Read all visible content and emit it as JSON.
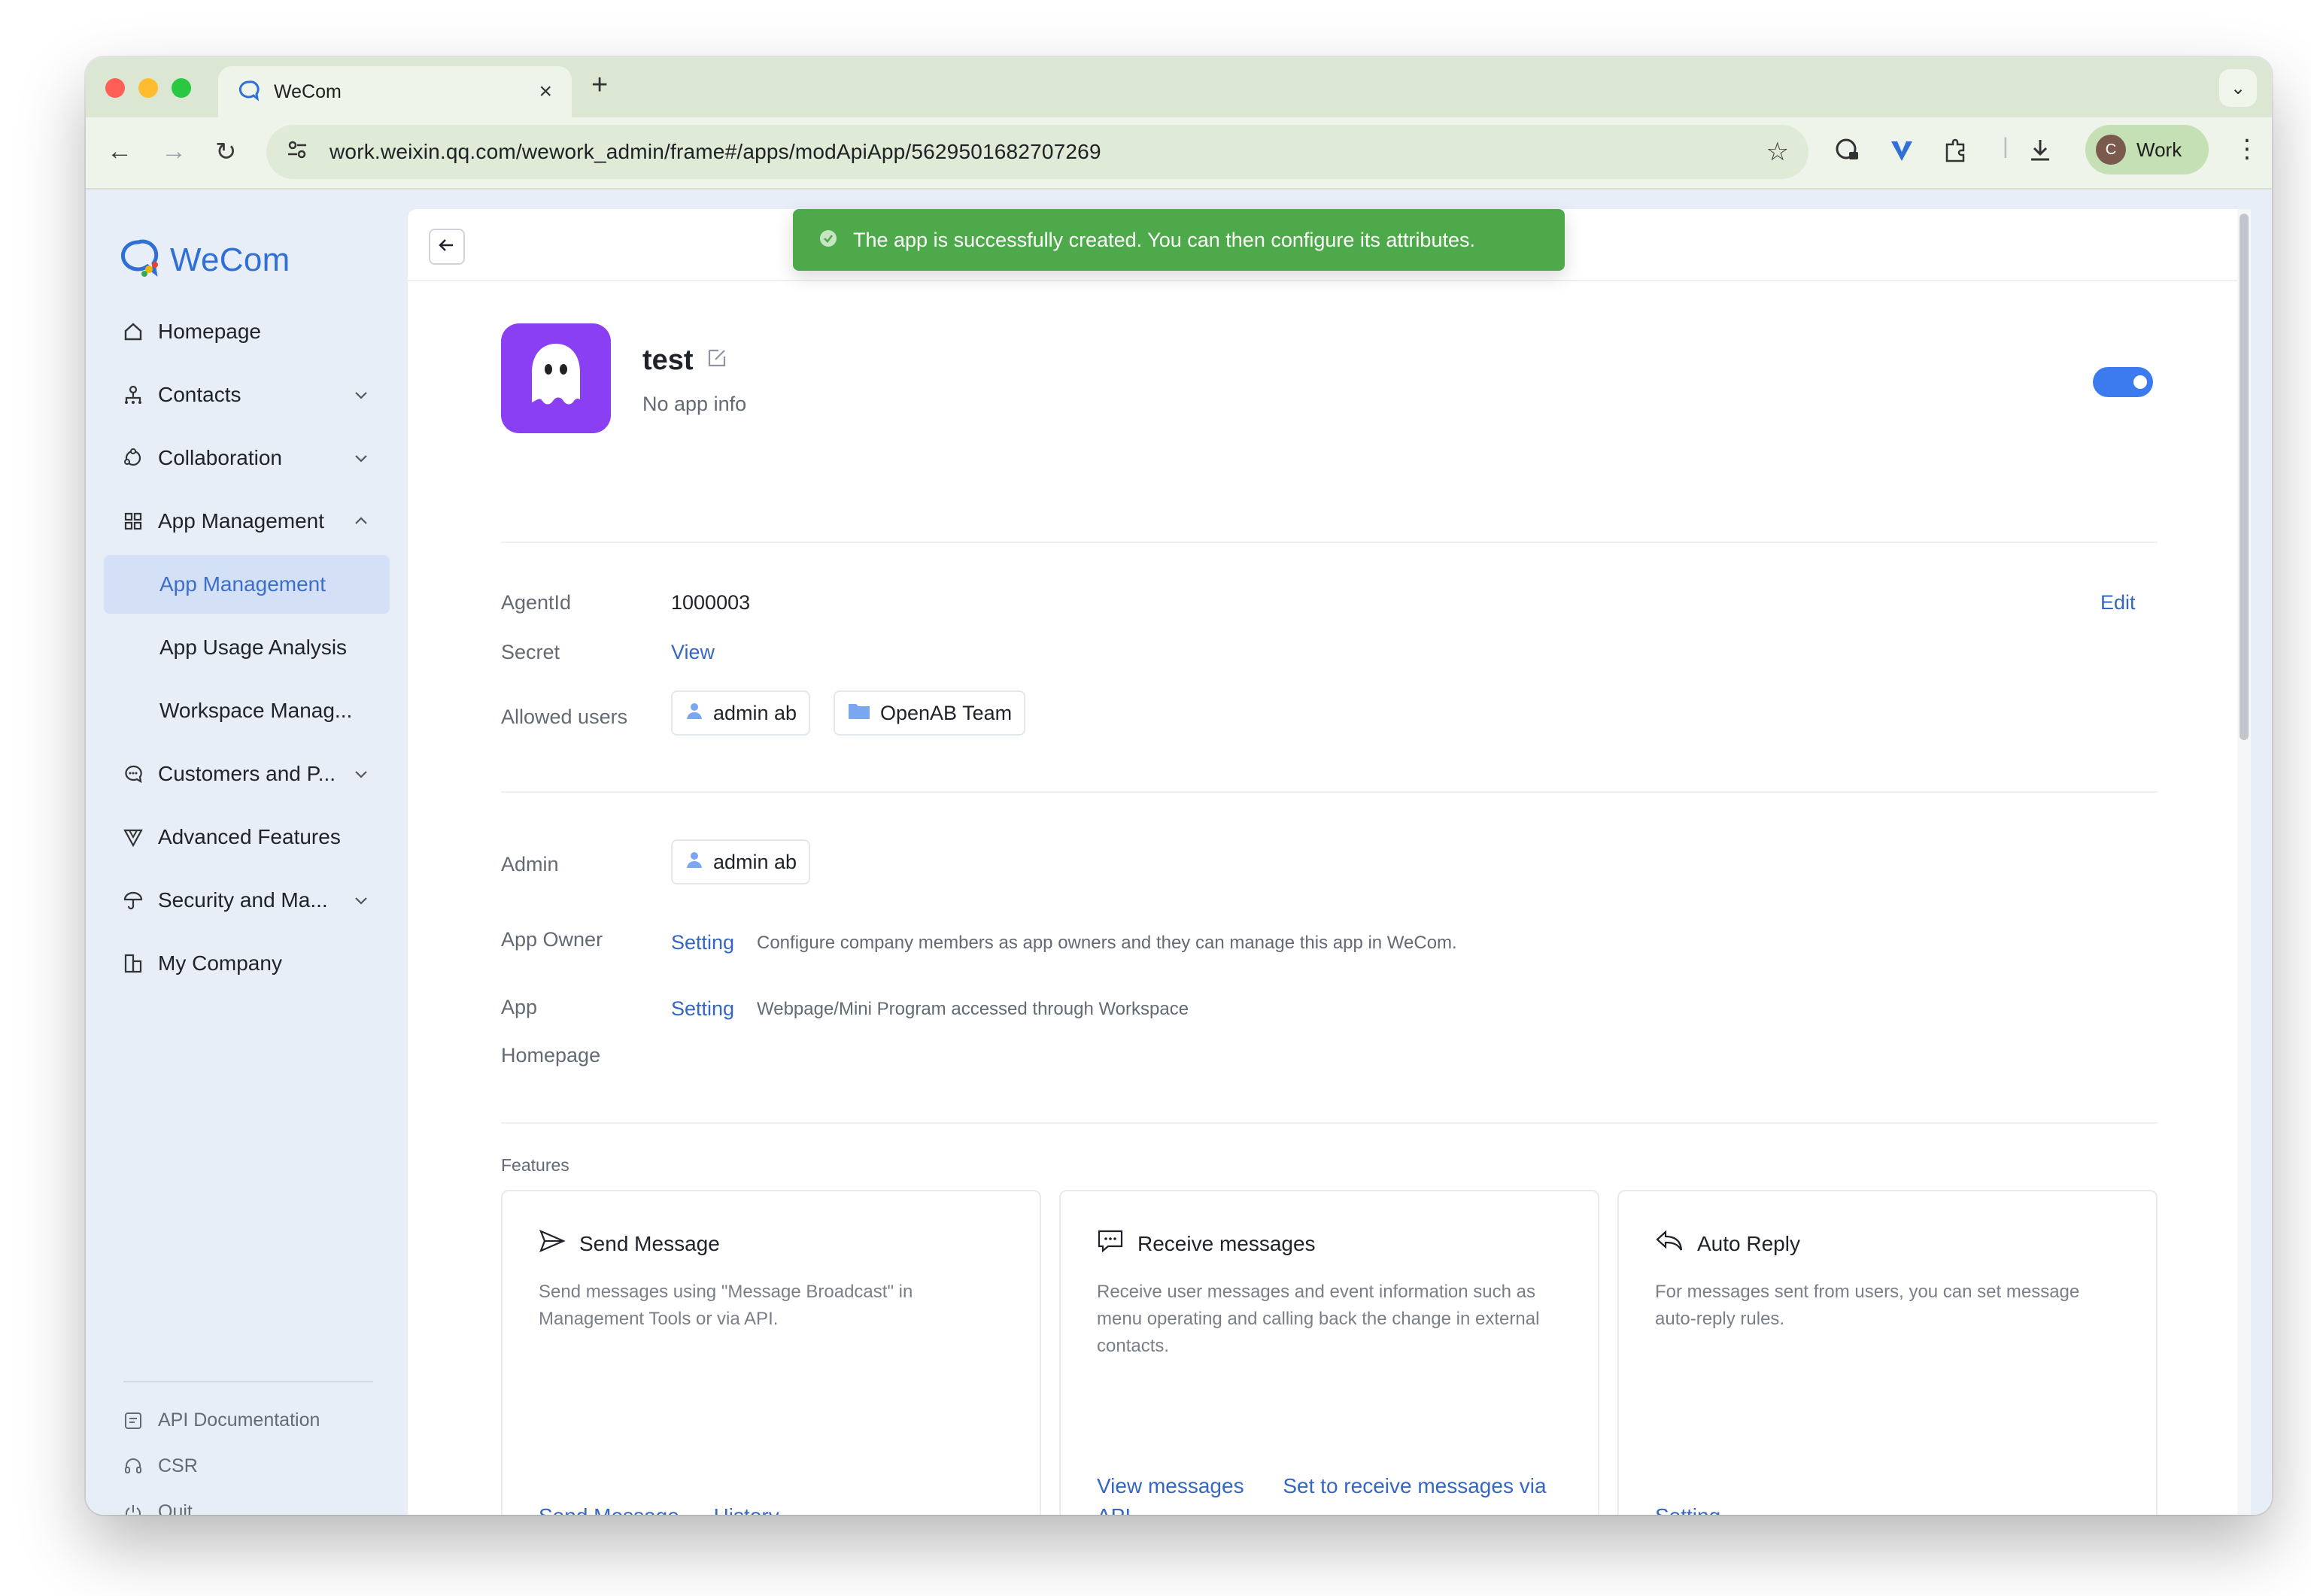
{
  "browser": {
    "tab_title": "WeCom",
    "url": "work.weixin.qq.com/wework_admin/frame#/apps/modApiApp/5629501682707269",
    "profile_initial": "C",
    "profile_label": "Work"
  },
  "sidebar": {
    "brand": "WeCom",
    "items": [
      {
        "label": "Homepage"
      },
      {
        "label": "Contacts"
      },
      {
        "label": "Collaboration"
      },
      {
        "label": "App Management"
      },
      {
        "label": "App Management"
      },
      {
        "label": "App Usage Analysis"
      },
      {
        "label": "Workspace Manag..."
      },
      {
        "label": "Customers and P..."
      },
      {
        "label": "Advanced Features"
      },
      {
        "label": "Security and Ma..."
      },
      {
        "label": "My Company"
      }
    ],
    "bottom": [
      {
        "label": "API Documentation"
      },
      {
        "label": "CSR"
      },
      {
        "label": "Quit"
      }
    ]
  },
  "toast": {
    "text": "The app is successfully created. You can then configure its attributes."
  },
  "app": {
    "name": "test",
    "info": "No app info",
    "enabled": true
  },
  "details": {
    "agentid_label": "AgentId",
    "agentid_value": "1000003",
    "edit_label": "Edit",
    "secret_label": "Secret",
    "secret_link": "View",
    "allowed_label": "Allowed users",
    "allowed_users": [
      "admin ab",
      "OpenAB Team"
    ],
    "admin_label": "Admin",
    "admin_user": "admin ab",
    "owner_label": "App Owner",
    "owner_link": "Setting",
    "owner_desc": "Configure company members as app owners and they can manage this app in WeCom.",
    "homepage_label_1": "App",
    "homepage_label_2": "Homepage",
    "homepage_link": "Setting",
    "homepage_desc": "Webpage/Mini Program accessed through Workspace"
  },
  "features": {
    "label": "Features",
    "cards": [
      {
        "title": "Send Message",
        "desc": "Send messages using \"Message Broadcast\" in Management Tools or via API.",
        "links": [
          "Send Message",
          "History"
        ]
      },
      {
        "title": "Receive messages",
        "desc": "Receive user messages and event information such as menu operating and calling back the change in external contacts.",
        "links": [
          "View messages",
          "Set to receive messages via API"
        ]
      },
      {
        "title": "Auto Reply",
        "desc": "For messages sent from users, you can set message auto-reply rules.",
        "links": [
          "Setting"
        ]
      }
    ]
  },
  "colors": {
    "accent": "#3466c2",
    "toast_green": "#4ea94a",
    "app_icon": "#8b3ff2",
    "toggle_on": "#3b7bef"
  }
}
